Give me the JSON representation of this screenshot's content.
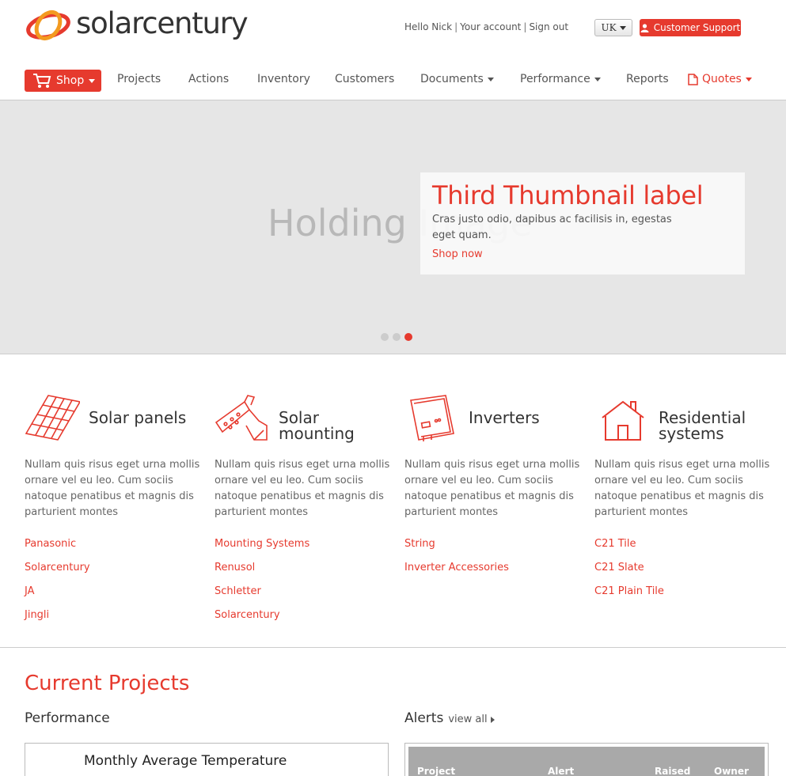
{
  "brand": {
    "name": "solarcentury",
    "accent": "#e63a2e"
  },
  "header": {
    "greeting": "Hello Nick",
    "your_account": "Your account",
    "sign_out": "Sign out",
    "language": "UK",
    "support": "Customer Support"
  },
  "nav": {
    "shop": "Shop",
    "items": [
      "Projects",
      "Actions",
      "Inventory",
      "Customers",
      "Documents",
      "Performance",
      "Reports"
    ],
    "quotes": "Quotes"
  },
  "hero": {
    "holding": "Holding Image",
    "caption_title": "Third Thumbnail label",
    "caption_text": "Cras justo odio, dapibus ac facilisis in, egestas eget quam.",
    "caption_link": "Shop now",
    "slides": 3,
    "active_slide": 3
  },
  "categories": [
    {
      "title": "Solar panels",
      "icon": "solar-panel-icon",
      "desc": "Nullam quis risus eget urna mollis ornare vel eu leo. Cum sociis natoque penatibus et magnis dis parturient montes",
      "links": [
        "Panasonic",
        "Solarcentury",
        "JA",
        "Jingli"
      ]
    },
    {
      "title": "Solar mounting",
      "icon": "mounting-bracket-icon",
      "desc": "Nullam quis risus eget urna mollis ornare vel eu leo. Cum sociis natoque penatibus et magnis dis parturient montes",
      "links": [
        "Mounting Systems",
        "Renusol",
        "Schletter",
        "Solarcentury"
      ]
    },
    {
      "title": "Inverters",
      "icon": "inverter-icon",
      "desc": "Nullam quis risus eget urna mollis ornare vel eu leo. Cum sociis natoque penatibus et magnis dis parturient montes",
      "links": [
        "String",
        "Inverter Accessories"
      ]
    },
    {
      "title": "Residential systems",
      "icon": "house-icon",
      "desc": "Nullam quis risus eget urna mollis ornare vel eu leo. Cum sociis natoque penatibus et magnis dis parturient montes",
      "links": [
        "C21 Tile",
        "C21 Slate",
        "C21 Plain Tile"
      ]
    }
  ],
  "projects": {
    "title": "Current Projects",
    "performance": "Performance",
    "chart_title": "Monthly Average Temperature",
    "alerts": "Alerts",
    "view_all": "view all",
    "columns": [
      "Project",
      "Alert",
      "Raised",
      "Owner"
    ]
  }
}
